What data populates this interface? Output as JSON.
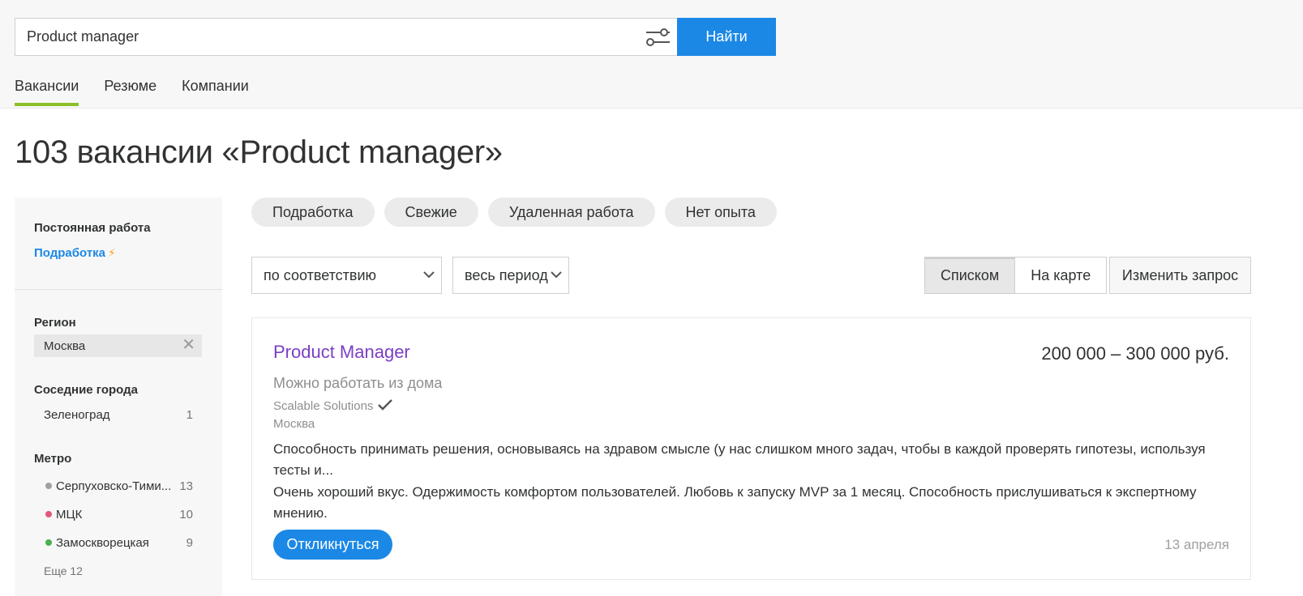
{
  "search": {
    "value": "Product manager",
    "button_label": "Найти"
  },
  "nav": {
    "tabs": [
      {
        "label": "Вакансии",
        "active": true
      },
      {
        "label": "Резюме",
        "active": false
      },
      {
        "label": "Компании",
        "active": false
      }
    ]
  },
  "page_title": "103 вакансии «Product manager»",
  "sidebar": {
    "employment_heading": "Постоянная работа",
    "parttime_link": "Подработка",
    "region_heading": "Регион",
    "region_value": "Москва",
    "nearby_heading": "Соседние города",
    "nearby": [
      {
        "name": "Зеленоград",
        "count": "1"
      }
    ],
    "metro_heading": "Метро",
    "metro": [
      {
        "name": "Серпуховско-Тими...",
        "count": "13",
        "color": "#a0a0a0"
      },
      {
        "name": "МЦК",
        "count": "10",
        "color": "#e05a7a"
      },
      {
        "name": "Замоскворецкая",
        "count": "9",
        "color": "#4caf50"
      }
    ],
    "more_label": "Еще 12"
  },
  "quick_filters": [
    "Подработка",
    "Свежие",
    "Удаленная работа",
    "Нет опыта"
  ],
  "sort": {
    "order": "по соответствию",
    "period": "весь период"
  },
  "view": {
    "list_label": "Списком",
    "map_label": "На карте",
    "change_label": "Изменить запрос"
  },
  "vacancy": {
    "title": "Product Manager",
    "salary": "200 000 – 300 000 руб.",
    "remote": "Можно работать из дома",
    "company": "Scalable Solutions",
    "city": "Москва",
    "desc1": "Способность принимать решения, основываясь на здравом смысле (у нас слишком много задач, чтобы в каждой проверять гипотезы, используя тесты и...",
    "desc2": "Очень хороший вкус. Одержимость комфортом пользователей. Любовь к запуску MVP за 1 месяц. Способность прислушиваться к экспертному мнению.",
    "apply_label": "Откликнуться",
    "date": "13 апреля"
  },
  "colors": {
    "accent_blue": "#1b88e6",
    "tab_underline": "#8cbf26",
    "vacancy_title": "#7b3fc4",
    "bolt": "#f5a623"
  },
  "icons": {
    "filter": "sliders-icon",
    "close": "close-icon",
    "chevron": "chevron-down-icon",
    "verified": "checkmark-icon",
    "bolt": "lightning-icon"
  }
}
